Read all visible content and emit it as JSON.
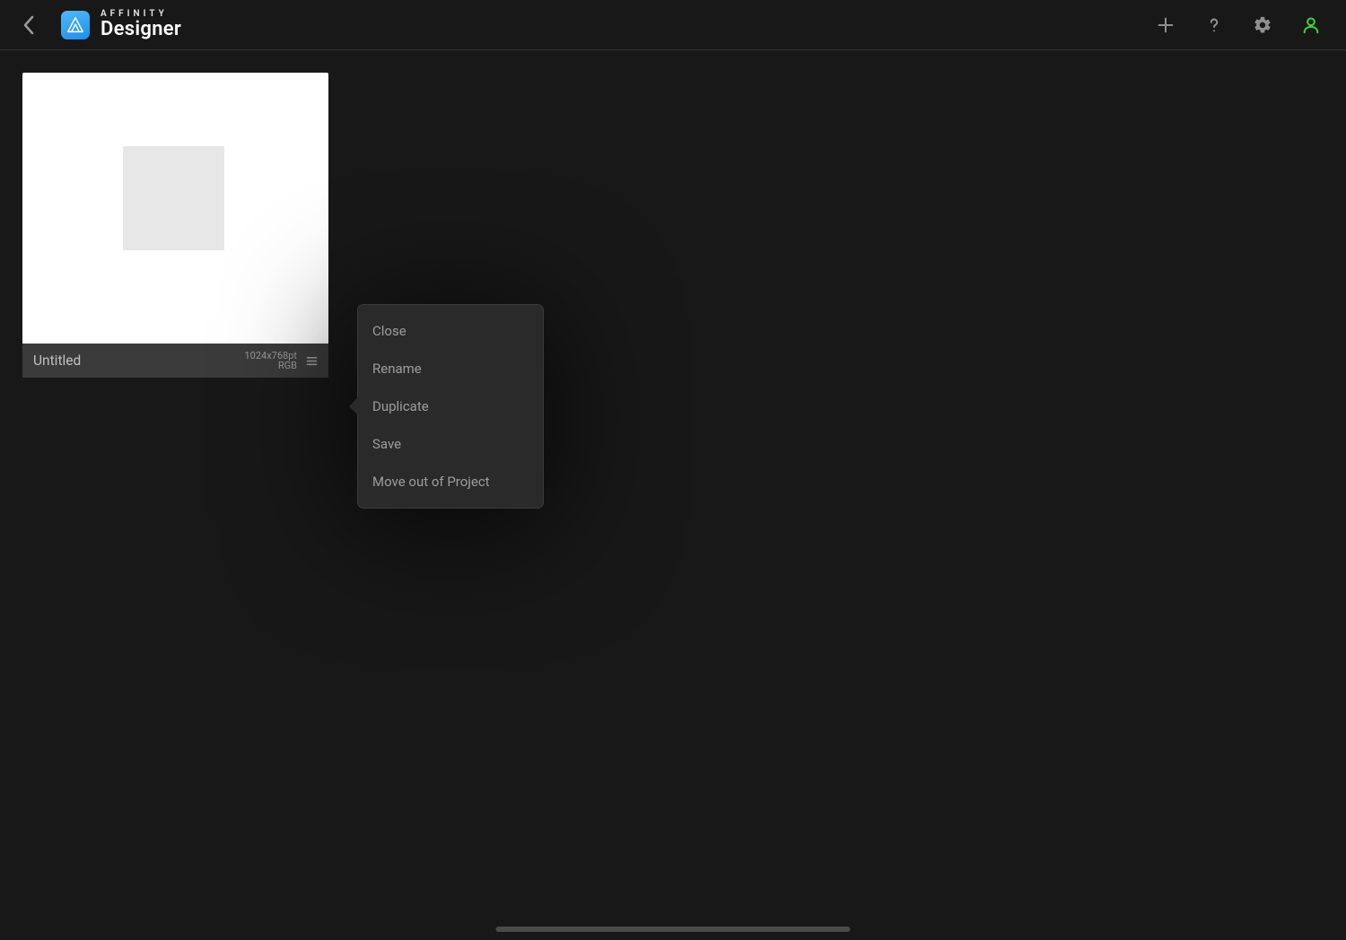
{
  "app": {
    "brand": "AFFINITY",
    "product": "Designer"
  },
  "document": {
    "name": "Untitled",
    "dimensions": "1024x768pt",
    "color_mode": "RGB"
  },
  "context_menu": {
    "items": [
      "Close",
      "Rename",
      "Duplicate",
      "Save",
      "Move out of Project"
    ]
  }
}
